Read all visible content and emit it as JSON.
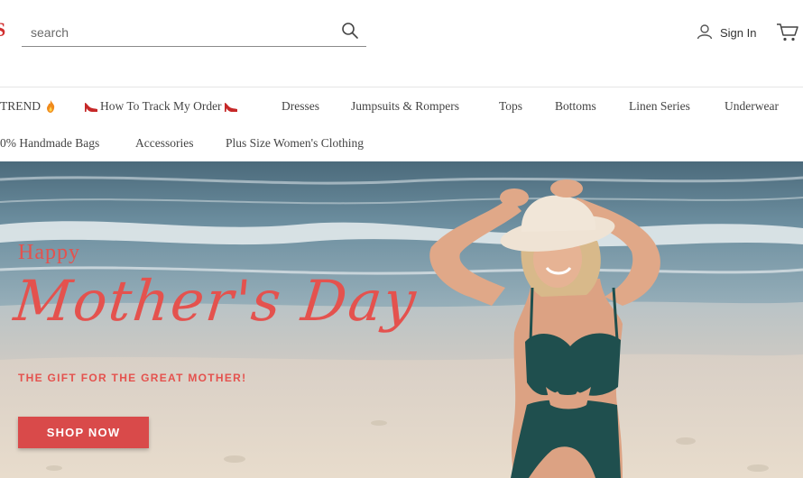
{
  "header": {
    "search": {
      "placeholder": "search"
    },
    "signin_label": "Sign In"
  },
  "nav": {
    "row1": [
      {
        "label": "TREND",
        "icon": "flame-icon"
      },
      {
        "label": "How To Track My Order",
        "icon": "high-heel-icon"
      },
      {
        "label": "Dresses"
      },
      {
        "label": "Jumpsuits & Rompers"
      },
      {
        "label": "Tops"
      },
      {
        "label": "Bottoms"
      },
      {
        "label": "Linen Series"
      },
      {
        "label": "Underwear"
      }
    ],
    "row2": [
      {
        "label": "0% Handmade Bags"
      },
      {
        "label": "Accessories"
      },
      {
        "label": "Plus Size Women's Clothing"
      }
    ]
  },
  "hero": {
    "line1": "Happy",
    "line2": "Mother's Day",
    "tagline": "THE GIFT FOR THE GREAT MOTHER!",
    "cta": "SHOP NOW",
    "accent_color": "#e4524e",
    "button_color": "#d94a4a"
  }
}
